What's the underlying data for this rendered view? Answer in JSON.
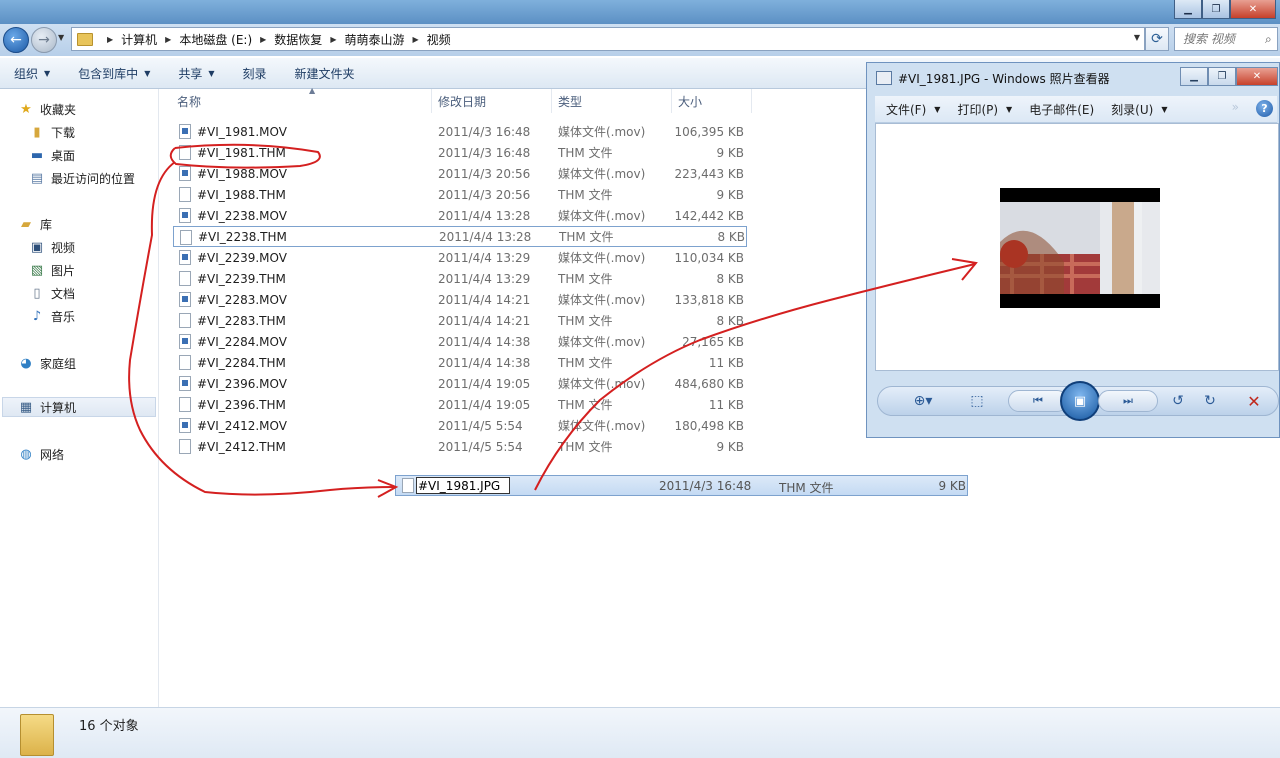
{
  "explorer": {
    "breadcrumbs": [
      "计算机",
      "本地磁盘 (E:)",
      "数据恢复",
      "萌萌泰山游",
      "视频"
    ],
    "search_placeholder": "搜索 视频",
    "toolbar": [
      {
        "label": "组织",
        "dropdown": true
      },
      {
        "label": "包含到库中",
        "dropdown": true
      },
      {
        "label": "共享",
        "dropdown": true
      },
      {
        "label": "刻录",
        "dropdown": false
      },
      {
        "label": "新建文件夹",
        "dropdown": false
      }
    ],
    "nav": {
      "favorites": {
        "label": "收藏夹",
        "items": [
          "下载",
          "桌面",
          "最近访问的位置"
        ]
      },
      "libraries": {
        "label": "库",
        "items": [
          "视频",
          "图片",
          "文档",
          "音乐"
        ]
      },
      "homegroup": "家庭组",
      "computer": "计算机",
      "network": "网络"
    },
    "columns": {
      "name": "名称",
      "date": "修改日期",
      "type": "类型",
      "size": "大小"
    },
    "files": [
      {
        "name": "#VI_1981.MOV",
        "date": "2011/4/3 16:48",
        "type": "媒体文件(.mov)",
        "size": "106,395 KB",
        "kind": "mov"
      },
      {
        "name": "#VI_1981.THM",
        "date": "2011/4/3 16:48",
        "type": "THM 文件",
        "size": "9 KB",
        "kind": "thm"
      },
      {
        "name": "#VI_1988.MOV",
        "date": "2011/4/3 20:56",
        "type": "媒体文件(.mov)",
        "size": "223,443 KB",
        "kind": "mov"
      },
      {
        "name": "#VI_1988.THM",
        "date": "2011/4/3 20:56",
        "type": "THM 文件",
        "size": "9 KB",
        "kind": "thm"
      },
      {
        "name": "#VI_2238.MOV",
        "date": "2011/4/4 13:28",
        "type": "媒体文件(.mov)",
        "size": "142,442 KB",
        "kind": "mov"
      },
      {
        "name": "#VI_2238.THM",
        "date": "2011/4/4 13:28",
        "type": "THM 文件",
        "size": "8 KB",
        "kind": "thm"
      },
      {
        "name": "#VI_2239.MOV",
        "date": "2011/4/4 13:29",
        "type": "媒体文件(.mov)",
        "size": "110,034 KB",
        "kind": "mov"
      },
      {
        "name": "#VI_2239.THM",
        "date": "2011/4/4 13:29",
        "type": "THM 文件",
        "size": "8 KB",
        "kind": "thm"
      },
      {
        "name": "#VI_2283.MOV",
        "date": "2011/4/4 14:21",
        "type": "媒体文件(.mov)",
        "size": "133,818 KB",
        "kind": "mov"
      },
      {
        "name": "#VI_2283.THM",
        "date": "2011/4/4 14:21",
        "type": "THM 文件",
        "size": "8 KB",
        "kind": "thm"
      },
      {
        "name": "#VI_2284.MOV",
        "date": "2011/4/4 14:38",
        "type": "媒体文件(.mov)",
        "size": "27,165 KB",
        "kind": "mov"
      },
      {
        "name": "#VI_2284.THM",
        "date": "2011/4/4 14:38",
        "type": "THM 文件",
        "size": "11 KB",
        "kind": "thm"
      },
      {
        "name": "#VI_2396.MOV",
        "date": "2011/4/4 19:05",
        "type": "媒体文件(.mov)",
        "size": "484,680 KB",
        "kind": "mov"
      },
      {
        "name": "#VI_2396.THM",
        "date": "2011/4/4 19:05",
        "type": "THM 文件",
        "size": "11 KB",
        "kind": "thm"
      },
      {
        "name": "#VI_2412.MOV",
        "date": "2011/4/5 5:54",
        "type": "媒体文件(.mov)",
        "size": "180,498 KB",
        "kind": "mov"
      },
      {
        "name": "#VI_2412.THM",
        "date": "2011/4/5 5:54",
        "type": "THM 文件",
        "size": "9 KB",
        "kind": "thm"
      }
    ],
    "rename": {
      "value": "#VI_1981.JPG",
      "date": "2011/4/3 16:48",
      "type": "THM 文件",
      "size": "9 KB"
    },
    "status": "16 个对象"
  },
  "viewer": {
    "title": "#VI_1981.JPG - Windows 照片查看器",
    "menu": [
      {
        "label": "文件(F)"
      },
      {
        "label": "打印(P)"
      },
      {
        "label": "电子邮件(E)"
      },
      {
        "label": "刻录(U)"
      }
    ],
    "help": "?"
  },
  "annotation_color": "#d42020"
}
